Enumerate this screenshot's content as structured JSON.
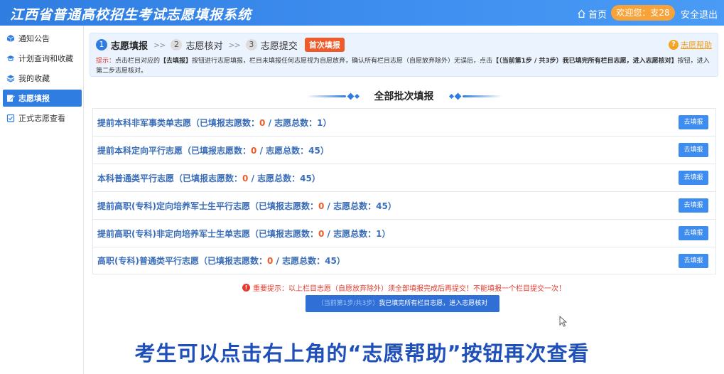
{
  "header": {
    "title": "江西省普通高校招生考试志愿填报系统",
    "home": "首页",
    "welcome": "欢迎您：支28",
    "logout": "安全退出"
  },
  "sidebar": {
    "items": [
      {
        "label": "通知公告",
        "icon": "cube-icon"
      },
      {
        "label": "计划查询和收藏",
        "icon": "graduation-cap-icon"
      },
      {
        "label": "我的收藏",
        "icon": "layers-icon"
      },
      {
        "label": "志愿填报",
        "icon": "edit-icon",
        "active": true
      },
      {
        "label": "正式志愿查看",
        "icon": "clipboard-check-icon"
      }
    ]
  },
  "steps": {
    "items": [
      {
        "num": "1",
        "label": "志愿填报"
      },
      {
        "num": "2",
        "label": "志愿核对"
      },
      {
        "num": "3",
        "label": "志愿提交"
      }
    ],
    "separator": ">>",
    "badge": "首次填报",
    "help": "志愿帮助"
  },
  "tip": {
    "prefix": "提示：",
    "part1": "点击栏目对应的",
    "bold1": "【去填报】",
    "part2": "按钮进行志愿填报，栏目未填报任何志愿视为自愿放弃，确认所有栏目志愿（自愿放弃除外）无误后，点击",
    "bold2": "【（当前第1步 / 共3步）我已填完所有栏目志愿，进入志愿核对】",
    "part3": "按钮，进入第二步志愿核对。"
  },
  "section": {
    "title": "全部批次填报"
  },
  "batches": [
    {
      "name": "提前本科非军事类单志愿",
      "pre": "（已填报志愿数：",
      "filled": "0",
      "mid": " / 志愿总数：",
      "total": "1",
      "post": "）"
    },
    {
      "name": "提前本科定向平行志愿",
      "pre": "（已填报志愿数：",
      "filled": "0",
      "mid": " / 志愿总数：",
      "total": "45",
      "post": "）"
    },
    {
      "name": "本科普通类平行志愿",
      "pre": "（已填报志愿数：",
      "filled": "0",
      "mid": " / 志愿总数：",
      "total": "45",
      "post": "）"
    },
    {
      "name": "提前高职(专科)定向培养军士生平行志愿",
      "pre": "（已填报志愿数：",
      "filled": "0",
      "mid": " / 志愿总数：",
      "total": "45",
      "post": "）"
    },
    {
      "name": "提前高职(专科)非定向培养军士生单志愿",
      "pre": "（已填报志愿数：",
      "filled": "0",
      "mid": " / 志愿总数：",
      "total": "1",
      "post": "）"
    },
    {
      "name": "高职(专科)普通类平行志愿",
      "pre": "（已填报志愿数：",
      "filled": "0",
      "mid": " / 志愿总数：",
      "total": "45",
      "post": "）"
    }
  ],
  "fill_button_label": "去填报",
  "important": "重要提示：以上栏目志愿（自愿放弃除外）须全部填报完成后再提交！不能填报一个栏目提交一次！",
  "confirm": {
    "step": "（当前第1步/共3步）",
    "text": "我已填完所有栏目志愿，进入志愿核对"
  },
  "caption": "考生可以点击右上角的“志愿帮助”按钮再次查看",
  "colors": {
    "primary": "#2f7de0",
    "accent_orange": "#ef5a2a",
    "welcome_bg": "#f7a33a",
    "warning_red": "#e23b2e"
  }
}
